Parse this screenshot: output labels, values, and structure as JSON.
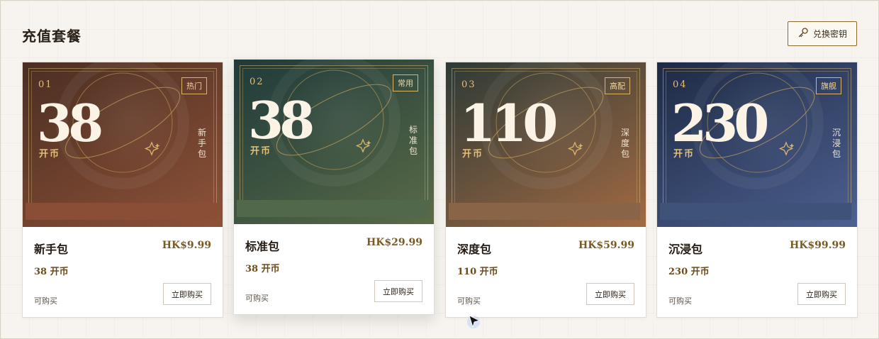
{
  "header": {
    "title": "充值套餐",
    "redeem_label": "兑换密钥",
    "redeem_icon": "key-icon"
  },
  "packages": [
    {
      "index": "01",
      "tag": "热门",
      "amount": "38",
      "unit": "开币",
      "vertical_name": "新手包",
      "name": "新手包",
      "price": "HK$9.99",
      "coins": "38 开币",
      "status": "可购买",
      "buy_label": "立即购买",
      "colors": {
        "from": "#4a2e22",
        "to": "#8e5238",
        "band": "#8a4d36"
      }
    },
    {
      "index": "02",
      "tag": "常用",
      "amount": "38",
      "unit": "开币",
      "vertical_name": "标准包",
      "name": "标准包",
      "price": "HK$29.99",
      "coins": "38 开币",
      "status": "可购买",
      "buy_label": "立即购买",
      "colors": {
        "from": "#1f3a3a",
        "to": "#5a6b47",
        "band": "#52684a"
      }
    },
    {
      "index": "03",
      "tag": "高配",
      "amount": "110",
      "unit": "开币",
      "vertical_name": "深度包",
      "name": "深度包",
      "price": "HK$59.99",
      "coins": "110 开币",
      "status": "可购买",
      "buy_label": "立即购买",
      "colors": {
        "from": "#2d3a36",
        "to": "#a26a43",
        "band": "#8a6446"
      }
    },
    {
      "index": "04",
      "tag": "旗舰",
      "amount": "230",
      "unit": "开币",
      "vertical_name": "沉浸包",
      "name": "沉浸包",
      "price": "HK$99.99",
      "coins": "230 开币",
      "status": "可购买",
      "buy_label": "立即购买",
      "colors": {
        "from": "#1e2a44",
        "to": "#4d6090",
        "band": "#3f5378"
      }
    }
  ]
}
